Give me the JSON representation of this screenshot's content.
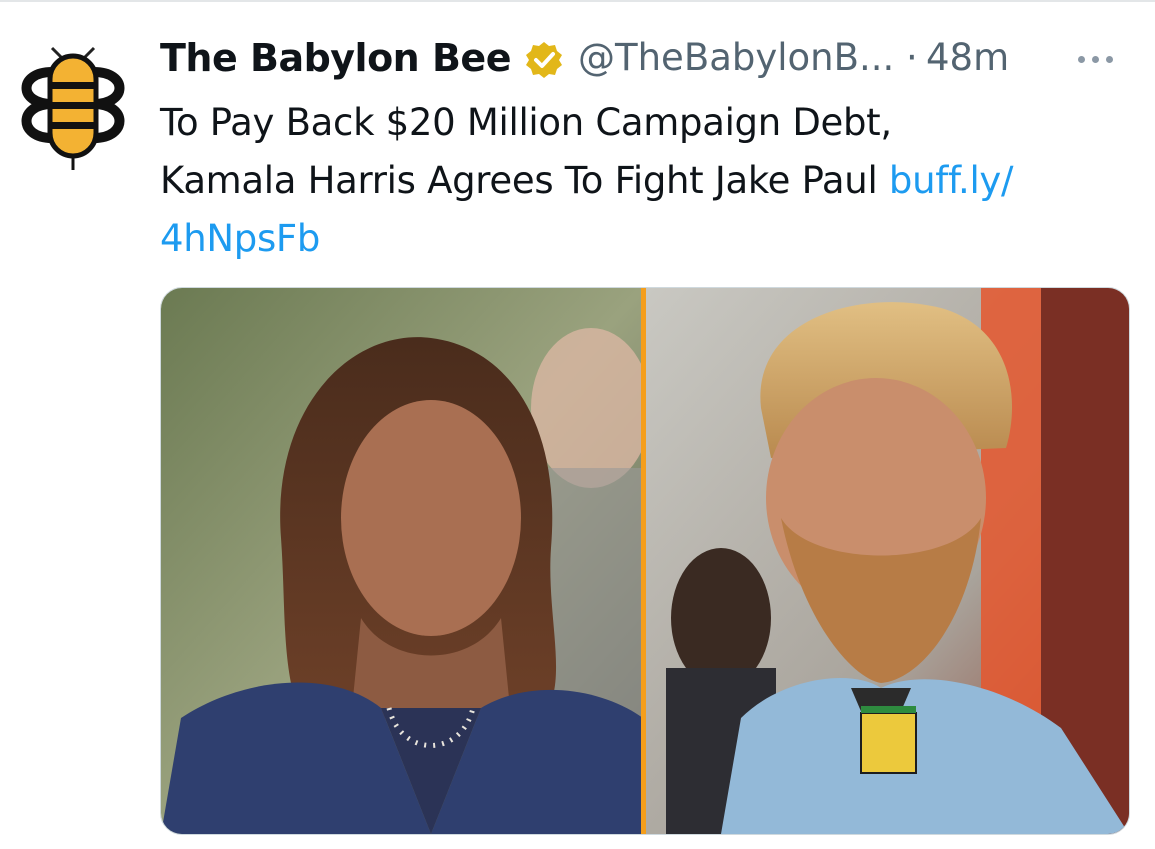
{
  "tweet": {
    "author": {
      "name": "The Babylon Bee",
      "handle": "@TheBabylonB...",
      "verified_badge": "gold-verified-badge-icon",
      "avatar": "bee-logo-icon"
    },
    "separator": "·",
    "timestamp": "48m",
    "more_icon": "more-horizontal-icon",
    "text": {
      "line1": "To Pay Back $20 Million Campaign Debt,",
      "line2": "Kamala Harris Agrees To Fight Jake Paul ",
      "link_part1": "buff.ly/",
      "link_part2": "4hNpsFb"
    },
    "media": {
      "type": "split-photo",
      "divider_color": "#f59e1b"
    }
  },
  "colors": {
    "text": "#0f1419",
    "secondary": "#536471",
    "link": "#1d9bf0",
    "badge": "#e2b719",
    "bee_yellow": "#f3b233"
  }
}
